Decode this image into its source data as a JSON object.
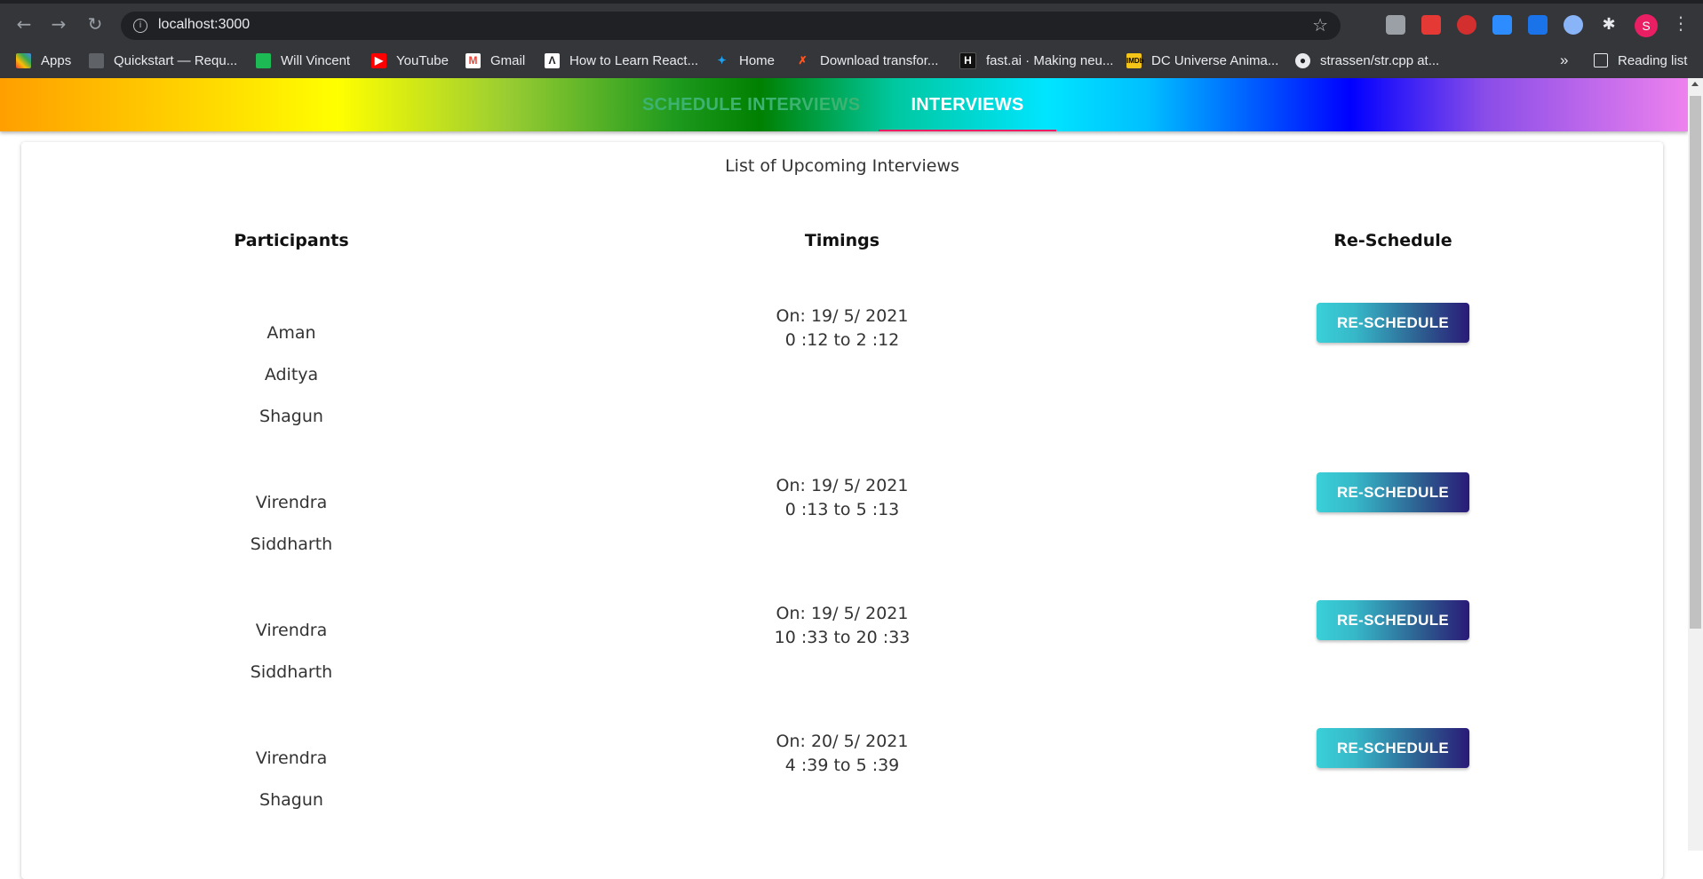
{
  "browser": {
    "url": "localhost:3000",
    "bookmarks": [
      {
        "label": "Apps",
        "icon": "apps-grid-icon",
        "color": "#4285f4"
      },
      {
        "label": "Quickstart — Requ...",
        "icon": "book-icon",
        "color": "#9aa0a6"
      },
      {
        "label": "Will Vincent",
        "icon": "green-square-icon",
        "color": "#1db954"
      },
      {
        "label": "YouTube",
        "icon": "youtube-icon",
        "color": "#ff0000"
      },
      {
        "label": "Gmail",
        "icon": "gmail-icon",
        "color": "#ea4335"
      },
      {
        "label": "How to Learn React...",
        "icon": "react-icon",
        "color": "#202124"
      },
      {
        "label": "Home",
        "icon": "twitter-icon",
        "color": "#1da1f2"
      },
      {
        "label": "Download transfor...",
        "icon": "x-icon",
        "color": "#ff5722"
      },
      {
        "label": "fast.ai · Making neu...",
        "icon": "h-icon",
        "color": "#111111"
      },
      {
        "label": "DC Universe Anima...",
        "icon": "imdb-icon",
        "color": "#f5c518"
      },
      {
        "label": "strassen/str.cpp at...",
        "icon": "github-icon",
        "color": "#e8eaed"
      }
    ],
    "reading_list": "Reading list",
    "profile_initial": "S"
  },
  "app": {
    "tabs": [
      "SCHEDULE INTERVIEWS",
      "INTERVIEWS"
    ],
    "active_tab": "INTERVIEWS",
    "colors": {
      "tab_inactive": "#3cb371",
      "tab_active": "#ffffff",
      "indicator": "#e91e63"
    }
  },
  "main": {
    "title": "List of Upcoming Interviews",
    "columns": [
      "Participants",
      "Timings",
      "Re-Schedule"
    ],
    "interviews": [
      {
        "participants": [
          "Aman",
          "Aditya",
          "Shagun"
        ],
        "date": "On: 19/ 5/ 2021",
        "time": "0 :12 to 2 :12",
        "button": "RE-SCHEDULE"
      },
      {
        "participants": [
          "Virendra",
          "Siddharth"
        ],
        "date": "On: 19/ 5/ 2021",
        "time": "0 :13 to 5 :13",
        "button": "RE-SCHEDULE"
      },
      {
        "participants": [
          "Virendra",
          "Siddharth"
        ],
        "date": "On: 19/ 5/ 2021",
        "time": "10 :33 to 20 :33",
        "button": "RE-SCHEDULE"
      },
      {
        "participants": [
          "Virendra",
          "Shagun"
        ],
        "date": "On: 20/ 5/ 2021",
        "time": "4 :39 to 5 :39",
        "button": "RE-SCHEDULE"
      }
    ]
  }
}
